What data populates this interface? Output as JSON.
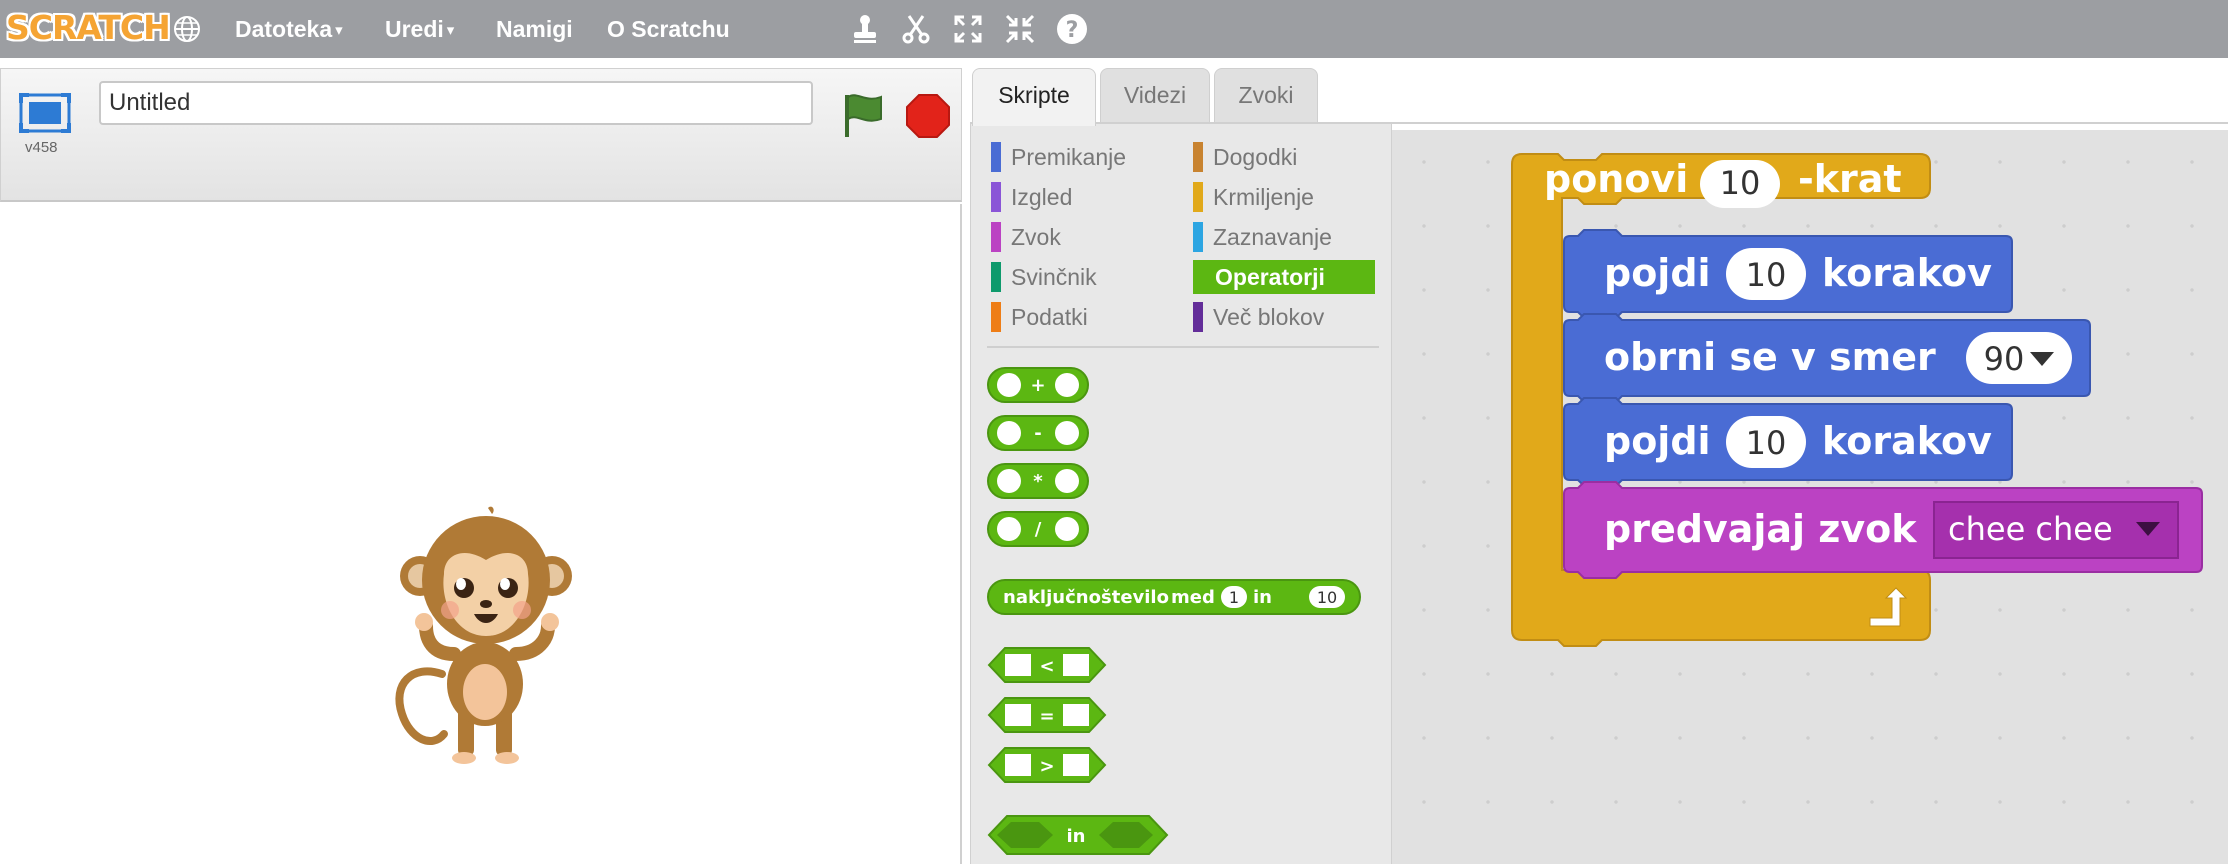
{
  "menu": {
    "logo_text": "SCRATCH",
    "file": "Datoteka",
    "edit": "Uredi",
    "tips": "Namigi",
    "about": "O Scratchu",
    "caret": "▾"
  },
  "stage": {
    "title_value": "Untitled",
    "version": "v458"
  },
  "tabs": [
    {
      "label": "Skripte"
    },
    {
      "label": "Videzi"
    },
    {
      "label": "Zvoki"
    }
  ],
  "categories": [
    {
      "label": "Premikanje",
      "color": "#4a6cd4"
    },
    {
      "label": "Izgled",
      "color": "#8a55d7"
    },
    {
      "label": "Zvok",
      "color": "#bb42c3"
    },
    {
      "label": "Svinčnik",
      "color": "#0e9a6c"
    },
    {
      "label": "Podatki",
      "color": "#ee7d16"
    },
    {
      "label": "Dogodki",
      "color": "#c88330"
    },
    {
      "label": "Krmiljenje",
      "color": "#e1a91a"
    },
    {
      "label": "Zaznavanje",
      "color": "#2ca5e2"
    },
    {
      "label": "Operatorji",
      "color": "#5cb712"
    },
    {
      "label": "Več blokov",
      "color": "#632d99"
    }
  ],
  "palette_blocks": {
    "add": "+",
    "subtract": "-",
    "multiply": "*",
    "divide": "/",
    "random_prefix": "naključno",
    "random_word2": "število",
    "random_word3": "med",
    "random_from": "1",
    "random_and": "in",
    "random_to": "10",
    "less": "<",
    "equals": "=",
    "greater": ">",
    "and": "in"
  },
  "script": {
    "repeat_label": "ponovi",
    "repeat_count": "10",
    "repeat_suffix": "-krat",
    "move1_label": "pojdi",
    "move1_steps": "10",
    "move1_suffix": "korakov",
    "turn_label": "obrni  se  v  smer",
    "turn_value": "90",
    "move2_label": "pojdi",
    "move2_steps": "10",
    "move2_suffix": "korakov",
    "sound_label": "predvajaj  zvok",
    "sound_value": "chee chee"
  },
  "colors": {
    "motion": "#4a6cd4",
    "control": "#e1a91a",
    "sound": "#bb42c3",
    "operators": "#5cb712",
    "topbar": "#9c9ea2"
  }
}
